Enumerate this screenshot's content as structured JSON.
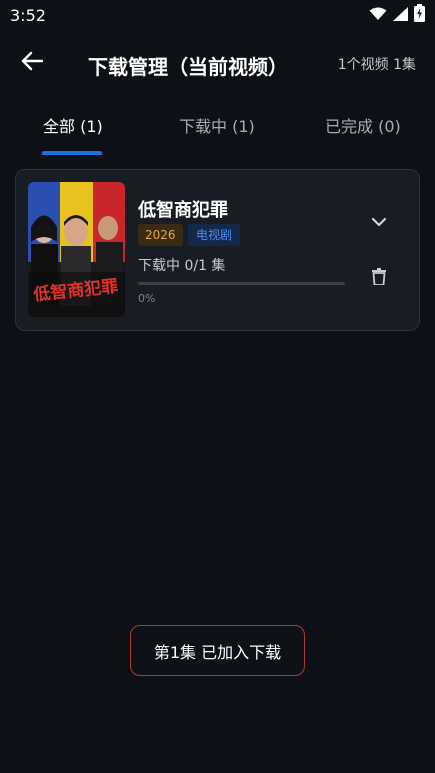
{
  "status_bar": {
    "time": "3:52",
    "icons": [
      "wifi-icon",
      "cell-signal-icon",
      "battery-icon"
    ]
  },
  "app_bar": {
    "back_icon": "arrow-left-icon",
    "title": "下载管理（当前视频）",
    "count": "1个视频 1集"
  },
  "tabs": [
    {
      "label": "全部 (1)",
      "active": true
    },
    {
      "label": "下载中 (1)",
      "active": false
    },
    {
      "label": "已完成 (0)",
      "active": false
    }
  ],
  "item": {
    "title": "低智商犯罪",
    "poster_text": "低智商犯罪",
    "year": "2026",
    "type": "电视剧",
    "status": "下载中 0/1 集",
    "progress_label": "0%",
    "progress": 0,
    "expand_icon": "chevron-down-icon",
    "delete_icon": "trash-icon"
  },
  "toast": {
    "message": "第1集 已加入下载"
  },
  "colors": {
    "background": "#0d1017",
    "card": "#181c24",
    "accent": "#1e6fe0",
    "year_badge_text": "#e8a53a",
    "type_badge_text": "#4c8df0",
    "toast_border": "#b23a33"
  }
}
